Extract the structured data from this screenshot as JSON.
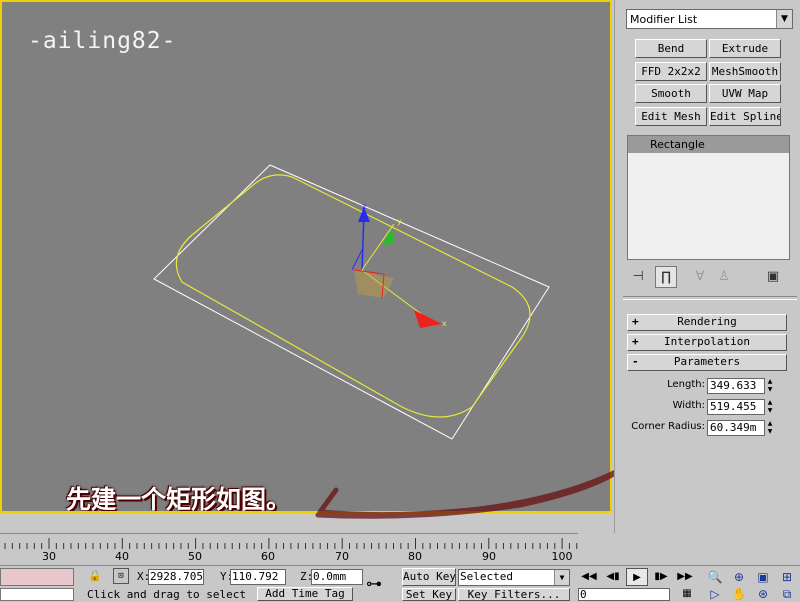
{
  "viewport": {
    "watermark": "-ailing82-",
    "caption": "先建一个矩形如图。",
    "gizmo_labels": {
      "z": "z",
      "y": "y",
      "x": "x"
    }
  },
  "command_panel": {
    "modifier_list": "Modifier List",
    "modifier_buttons": [
      "Bend",
      "Extrude",
      "FFD 2x2x2",
      "MeshSmooth",
      "Smooth",
      "UVW Map",
      "Edit Mesh",
      "Edit Spline"
    ],
    "stack_items": [
      "Rectangle"
    ],
    "rollouts": {
      "rendering": {
        "sign": "+",
        "label": "Rendering"
      },
      "interpolation": {
        "sign": "+",
        "label": "Interpolation"
      },
      "parameters": {
        "sign": "-",
        "label": "Parameters"
      }
    },
    "parameters": {
      "length_label": "Length:",
      "length_value": "349.633",
      "width_label": "Width:",
      "width_value": "519.455",
      "corner_radius_label": "Corner Radius:",
      "corner_radius_value": "60.349m"
    }
  },
  "timeline": {
    "ticks": [
      "30",
      "40",
      "50",
      "60",
      "70",
      "80",
      "90",
      "100"
    ]
  },
  "statusbar": {
    "x_label": "X:",
    "x_value": "2928.705",
    "y_label": "Y:",
    "y_value": "110.792",
    "z_label": "Z:",
    "z_value": "0.0mm",
    "auto_key": "Auto Key",
    "set_key": "Set Key",
    "selected_value": "Selected",
    "key_filters": "Key Filters...",
    "prompt": "Click and drag to select",
    "add_time_tag": "Add Time Tag",
    "frame_value": "0"
  },
  "colors": {
    "viewport_bg": "#808080",
    "active_border": "#f0d000",
    "shape_yellow": "#e8e83a",
    "bbox_white": "#ffffff",
    "annotation": "#6a1010"
  }
}
